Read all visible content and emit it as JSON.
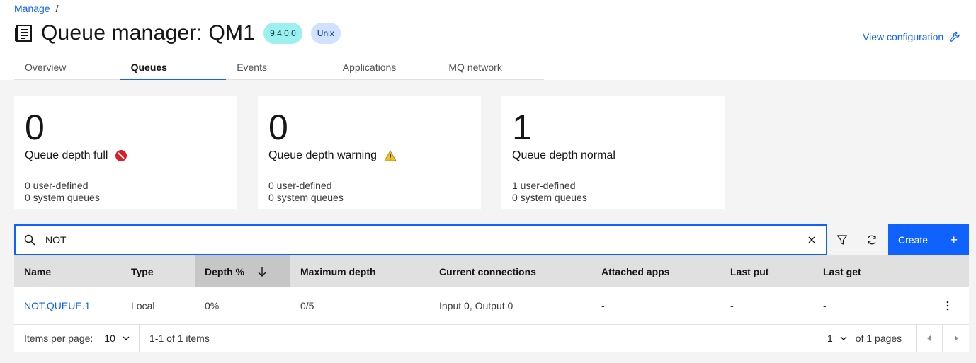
{
  "breadcrumb": {
    "root": "Manage",
    "separator": "/"
  },
  "header": {
    "title": "Queue manager: QM1",
    "version_tag": "9.4.0.0",
    "platform_tag": "Unix",
    "view_config_label": "View configuration"
  },
  "tabs": [
    {
      "label": "Overview",
      "active": false
    },
    {
      "label": "Queues",
      "active": true
    },
    {
      "label": "Events",
      "active": false
    },
    {
      "label": "Applications",
      "active": false
    },
    {
      "label": "MQ network",
      "active": false
    }
  ],
  "tiles": [
    {
      "value": "0",
      "label": "Queue depth full",
      "user_defined": "0  user-defined",
      "system": "0  system queues",
      "status_icon": "error-icon",
      "status_color": "#da1e28"
    },
    {
      "value": "0",
      "label": "Queue depth warning",
      "user_defined": "0  user-defined",
      "system": "0  system queues",
      "status_icon": "warning-icon",
      "status_color": "#f1c21b"
    },
    {
      "value": "1",
      "label": "Queue depth normal",
      "user_defined": "1  user-defined",
      "system": "0  system queues",
      "status_icon": "",
      "status_color": ""
    }
  ],
  "search": {
    "value": "NOT",
    "placeholder": ""
  },
  "toolbar": {
    "create_label": "Create",
    "create_icon": "+"
  },
  "table": {
    "columns": [
      "Name",
      "Type",
      "Depth %",
      "Maximum depth",
      "Current connections",
      "Attached apps",
      "Last put",
      "Last get"
    ],
    "rows": [
      {
        "name": "NOT.QUEUE.1",
        "type": "Local",
        "depth": "0%",
        "max_depth": "0/5",
        "connections": "Input 0, Output 0",
        "attached_apps": "-",
        "last_put": "-",
        "last_get": "-"
      }
    ]
  },
  "pagination": {
    "items_per_page_label": "Items per page:",
    "items_per_page": "10",
    "range": "1-1 of 1 items",
    "page": "1",
    "of_pages": "of 1 pages"
  },
  "colors": {
    "accent": "#0f62fe",
    "background": "#f4f4f4"
  }
}
